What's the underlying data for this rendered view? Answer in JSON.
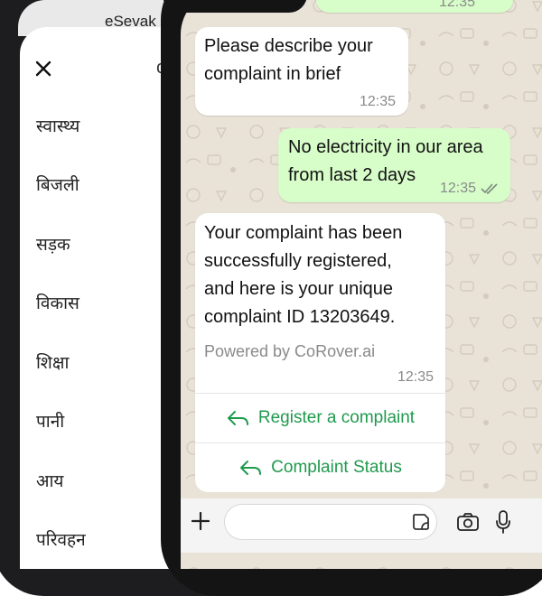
{
  "sidebar_app": {
    "title": "eSevak",
    "header_hint": "c",
    "menu_items": [
      "स्वास्थ्य",
      "बिजली",
      "सड़क",
      "विकास",
      "शिक्षा",
      "पानी",
      "आय",
      "परिवहन"
    ]
  },
  "chat": {
    "top_time": "12:35",
    "messages": [
      {
        "direction": "incoming",
        "line1": "Please describe your",
        "line2": "complaint in brief",
        "time": "12:35"
      },
      {
        "direction": "outgoing",
        "line1": "No electricity in our area",
        "line2": "from last 2 days",
        "time": "12:35"
      },
      {
        "direction": "incoming",
        "line1": "Your complaint has been",
        "line2": "successfully registered,",
        "line3": "and here is your unique",
        "line4": "complaint ID 13203649.",
        "footer": "Powered by CoRover.ai",
        "time": "12:35"
      }
    ],
    "buttons": [
      {
        "label": "Register a complaint",
        "icon": "reply-icon"
      },
      {
        "label": "Complaint Status",
        "icon": "reply-icon"
      }
    ],
    "input": {
      "value": "",
      "placeholder": ""
    }
  },
  "colors": {
    "outgoing_bubble": "#d7fdc9",
    "incoming_bubble": "#ffffff",
    "button_text": "#1f9a4d",
    "chat_wallpaper": "#e9e2d6"
  },
  "icons": [
    "close-icon",
    "reply-icon",
    "plus-icon",
    "sticker-icon",
    "camera-icon",
    "mic-icon",
    "double-check-icon"
  ]
}
